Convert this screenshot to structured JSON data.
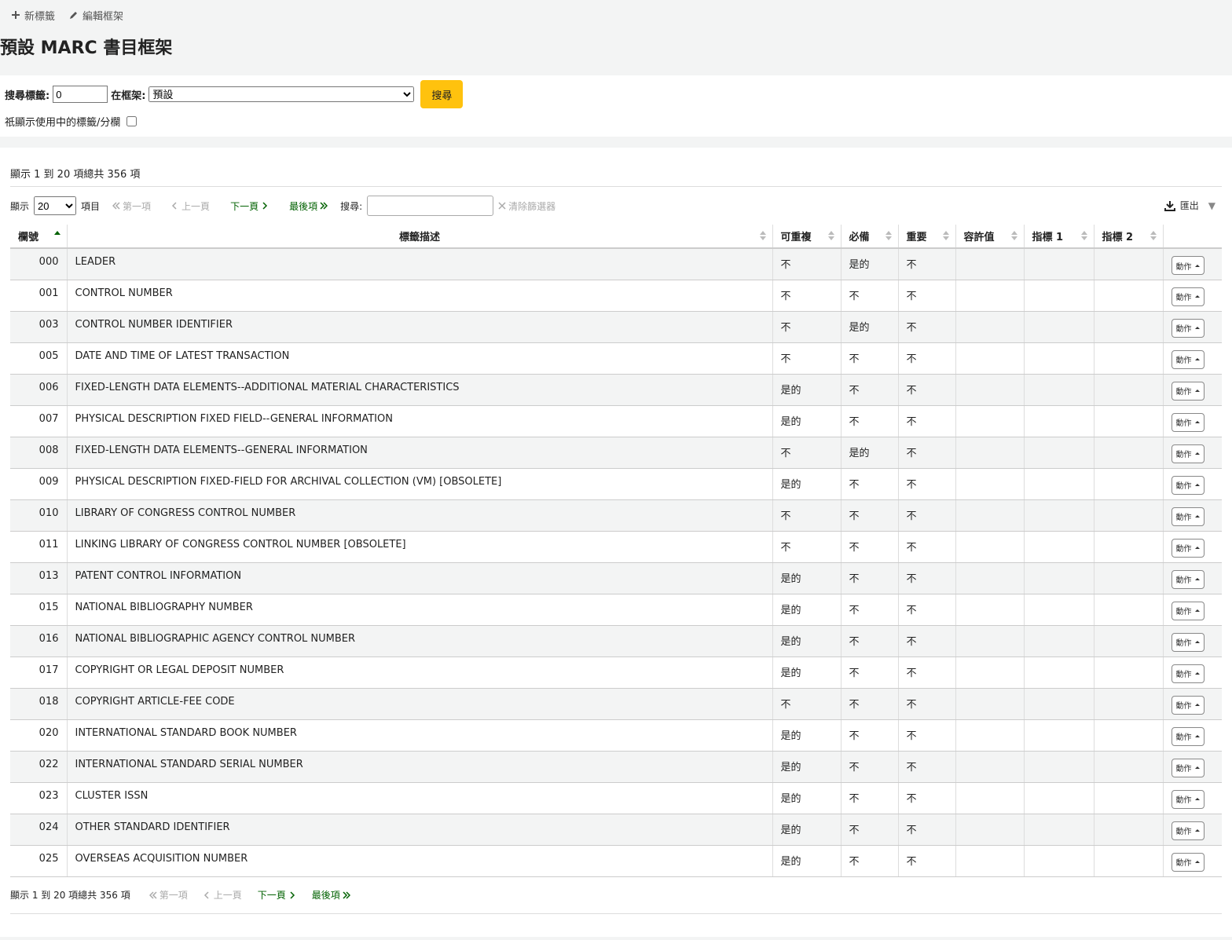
{
  "toolbar": {
    "new_tag": "新標籤",
    "edit_framework": "編輯框架"
  },
  "page_title": "預設 MARC 書目框架",
  "search": {
    "tag_label": "搜尋標籤:",
    "tag_value": "0",
    "framework_label": "在框架:",
    "framework_selected": "預設",
    "button": "搜尋",
    "used_only_label": "祇顯示使用中的標籤/分欄"
  },
  "table_info": "顯示 1 到 20 項總共 356 項",
  "pager": {
    "show_label": "顯示",
    "per_page": "20",
    "items_label": "項目",
    "first": "第一項",
    "prev": "上一頁",
    "next": "下一頁",
    "last": "最後項",
    "search_label": "搜尋:",
    "clear": "清除篩選器",
    "export": "匯出"
  },
  "columns": [
    "欄號",
    "標籤描述",
    "可重複",
    "必備",
    "重要",
    "容許值",
    "指標 1",
    "指標 2"
  ],
  "action_label": "動作",
  "rows": [
    {
      "tag": "000",
      "desc": "LEADER",
      "rep": "不",
      "mand": "是的",
      "imp": "不"
    },
    {
      "tag": "001",
      "desc": "CONTROL NUMBER",
      "rep": "不",
      "mand": "不",
      "imp": "不"
    },
    {
      "tag": "003",
      "desc": "CONTROL NUMBER IDENTIFIER",
      "rep": "不",
      "mand": "是的",
      "imp": "不"
    },
    {
      "tag": "005",
      "desc": "DATE AND TIME OF LATEST TRANSACTION",
      "rep": "不",
      "mand": "不",
      "imp": "不"
    },
    {
      "tag": "006",
      "desc": "FIXED-LENGTH DATA ELEMENTS--ADDITIONAL MATERIAL CHARACTERISTICS",
      "rep": "是的",
      "mand": "不",
      "imp": "不"
    },
    {
      "tag": "007",
      "desc": "PHYSICAL DESCRIPTION FIXED FIELD--GENERAL INFORMATION",
      "rep": "是的",
      "mand": "不",
      "imp": "不"
    },
    {
      "tag": "008",
      "desc": "FIXED-LENGTH DATA ELEMENTS--GENERAL INFORMATION",
      "rep": "不",
      "mand": "是的",
      "imp": "不"
    },
    {
      "tag": "009",
      "desc": "PHYSICAL DESCRIPTION FIXED-FIELD FOR ARCHIVAL COLLECTION (VM) [OBSOLETE]",
      "rep": "是的",
      "mand": "不",
      "imp": "不"
    },
    {
      "tag": "010",
      "desc": "LIBRARY OF CONGRESS CONTROL NUMBER",
      "rep": "不",
      "mand": "不",
      "imp": "不"
    },
    {
      "tag": "011",
      "desc": "LINKING LIBRARY OF CONGRESS CONTROL NUMBER [OBSOLETE]",
      "rep": "不",
      "mand": "不",
      "imp": "不"
    },
    {
      "tag": "013",
      "desc": "PATENT CONTROL INFORMATION",
      "rep": "是的",
      "mand": "不",
      "imp": "不"
    },
    {
      "tag": "015",
      "desc": "NATIONAL BIBLIOGRAPHY NUMBER",
      "rep": "是的",
      "mand": "不",
      "imp": "不"
    },
    {
      "tag": "016",
      "desc": "NATIONAL BIBLIOGRAPHIC AGENCY CONTROL NUMBER",
      "rep": "是的",
      "mand": "不",
      "imp": "不"
    },
    {
      "tag": "017",
      "desc": "COPYRIGHT OR LEGAL DEPOSIT NUMBER",
      "rep": "是的",
      "mand": "不",
      "imp": "不"
    },
    {
      "tag": "018",
      "desc": "COPYRIGHT ARTICLE-FEE CODE",
      "rep": "不",
      "mand": "不",
      "imp": "不"
    },
    {
      "tag": "020",
      "desc": "INTERNATIONAL STANDARD BOOK NUMBER",
      "rep": "是的",
      "mand": "不",
      "imp": "不"
    },
    {
      "tag": "022",
      "desc": "INTERNATIONAL STANDARD SERIAL NUMBER",
      "rep": "是的",
      "mand": "不",
      "imp": "不"
    },
    {
      "tag": "023",
      "desc": "CLUSTER ISSN",
      "rep": "是的",
      "mand": "不",
      "imp": "不"
    },
    {
      "tag": "024",
      "desc": "OTHER STANDARD IDENTIFIER",
      "rep": "是的",
      "mand": "不",
      "imp": "不"
    },
    {
      "tag": "025",
      "desc": "OVERSEAS ACQUISITION NUMBER",
      "rep": "是的",
      "mand": "不",
      "imp": "不"
    }
  ],
  "colors": {
    "accent_green": "#006100",
    "search_button": "#ffc20e",
    "stripe": "#f3f4f4"
  }
}
